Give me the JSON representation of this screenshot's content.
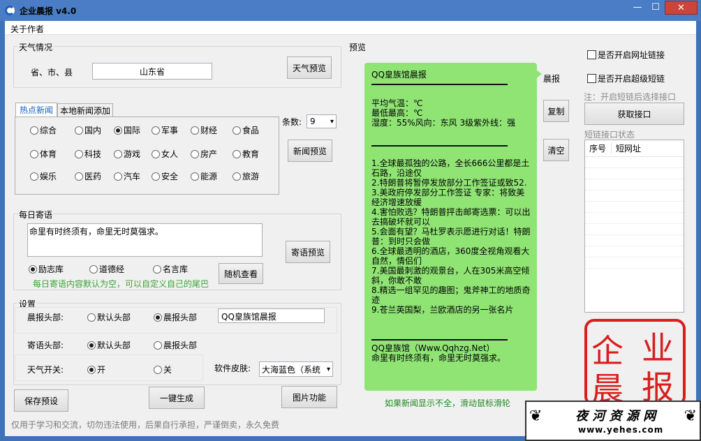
{
  "window": {
    "title": "企业晨报 v4.0",
    "min": "—",
    "max": "☐",
    "close": "✕"
  },
  "menu": {
    "about": "关于作者"
  },
  "weather": {
    "group_label": "天气情况",
    "region_label": "省、市、县",
    "region_value": "山东省",
    "preview_button": "天气预览"
  },
  "news": {
    "tabs": [
      "热点新闻",
      "本地新闻添加"
    ],
    "categories": [
      [
        "综合",
        "国内",
        "国际",
        "军事",
        "财经",
        "食品"
      ],
      [
        "体育",
        "科技",
        "游戏",
        "女人",
        "房产",
        "教育"
      ],
      [
        "娱乐",
        "医药",
        "汽车",
        "安全",
        "能源",
        "旅游"
      ]
    ],
    "selected": "国际",
    "count_label": "条数:",
    "count_value": "9",
    "preview_button": "新闻预览"
  },
  "message": {
    "group_label": "每日寄语",
    "text": "命里有时终须有，命里无时莫强求。",
    "preview_button": "寄语预览",
    "sources": [
      "励志库",
      "道德经",
      "名言库"
    ],
    "selected": "励志库",
    "random_button": "随机查看",
    "hint": "每日寄语内容默认为空，可以自定义自己的尾巴"
  },
  "settings": {
    "group_label": "设置",
    "header_label": "晨报头部:",
    "header_options": [
      "默认头部",
      "晨报头部"
    ],
    "header_selected": "晨报头部",
    "header_text": "QQ皇族馆晨报",
    "msg_header_label": "寄语头部:",
    "msg_header_options": [
      "默认头部",
      "晨报头部"
    ],
    "msg_header_selected": "默认头部",
    "weather_switch_label": "天气开关:",
    "weather_switch_options": [
      "开",
      "关"
    ],
    "weather_switch_selected": "开",
    "skin_label": "软件皮肤:",
    "skin_value": "大海蓝色（系统"
  },
  "actions": {
    "save": "保存预设",
    "generate": "一键生成",
    "image": "图片功能"
  },
  "footer": {
    "notice": "仅用于学习和交流，切勿违法使用，后果自行承担，严谨倒卖，永久免费"
  },
  "preview": {
    "label": "预览",
    "header": "QQ皇族馆晨报",
    "weather": "平均气温：℃\n最低最高：℃\n湿度：55%风向：东风 3级紫外线：强",
    "news": "1.全球最孤独的公路，全长666公里都是土石路，沿途仅\n2.特朗普将暂停发放部分工作签证或致52.\n3.美政府停发部分工作签证 专家：将致美经济增速放缓\n4.害怕败选？特朗普抨击邮寄选票：可以出去搞破坏就可以\n5.会面有望？马杜罗表示愿进行对话！特朗普：到时只会做\n6.全球最透明的酒店，360度全视角观看大自然，情侣们\n7.美国最刺激的观景台，人在305米高空倾斜，你敢不敢\n8.精选一组罕见的趣图；鬼斧神工的地质奇迹\n9.苍兰英国梨，兰欧酒店的另一张名片",
    "footer": "QQ皇族馆（Www.Qqhzg.Net）\n命里有时终须有，命里无时莫强求。",
    "side_label": "晨报",
    "copy_button": "复制",
    "clear_button": "清空",
    "scroll_hint": "如果新闻显示不全，滑动鼠标滑轮"
  },
  "shortlink": {
    "enable_url": "是否开启网址链接",
    "enable_short": "是否开启超级短链",
    "note": "注：开启短链后选择接口",
    "get_button": "获取接口",
    "status_label": "短链接口状态",
    "col_no": "序号",
    "col_url": "短网址"
  },
  "stamp": {
    "chars": [
      "企",
      "业",
      "晨",
      "报"
    ]
  },
  "watermark": {
    "text": "夜 河 资 源 网",
    "url": "www.yehes.com"
  }
}
